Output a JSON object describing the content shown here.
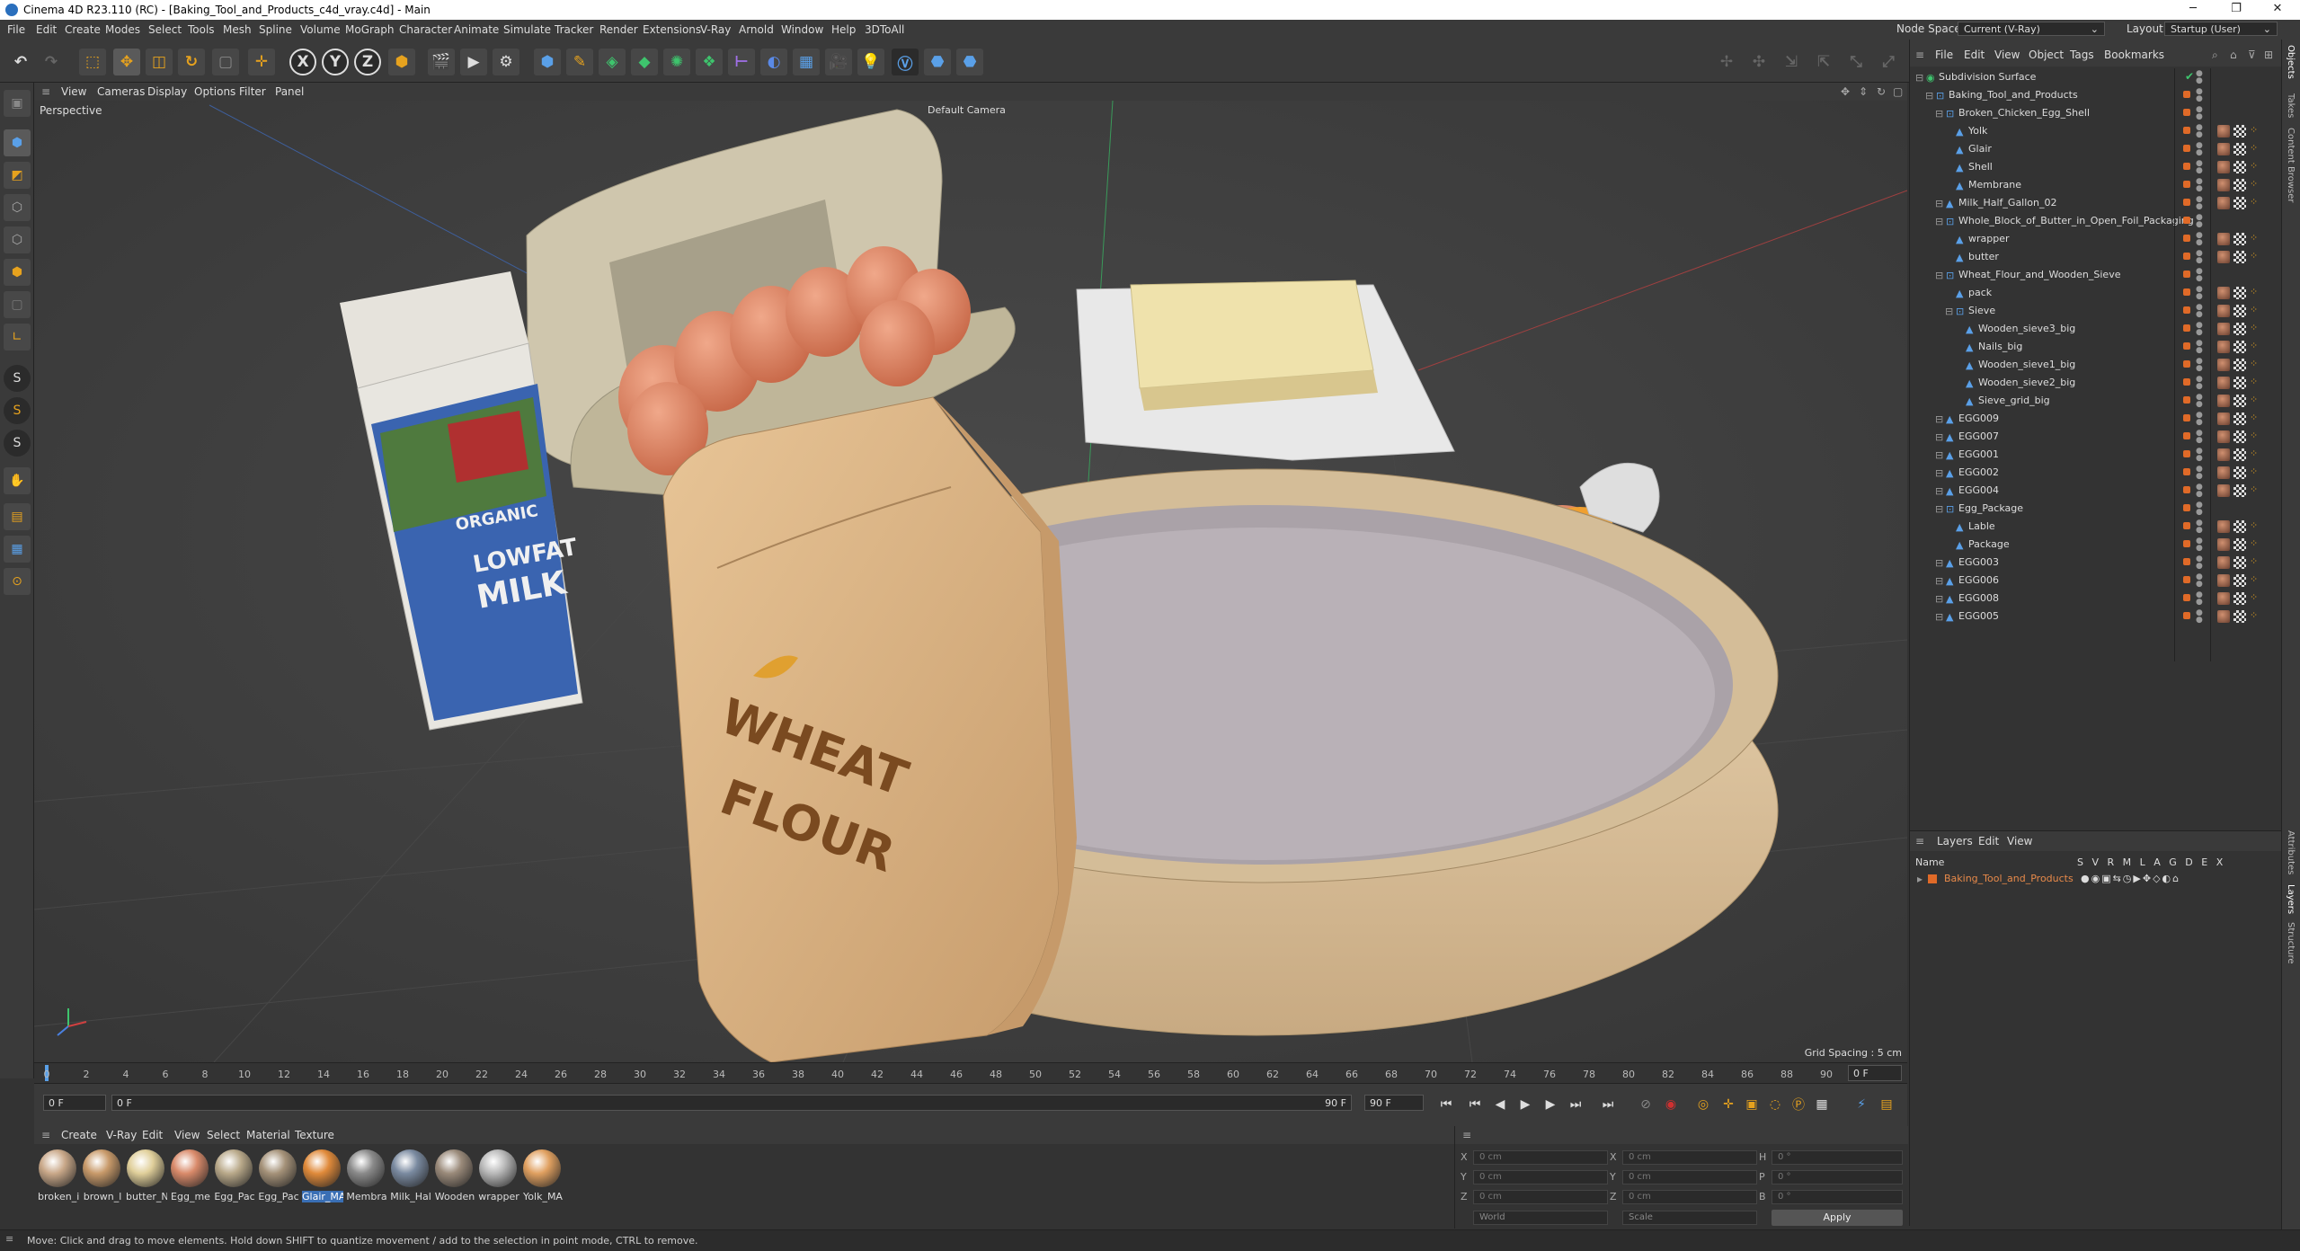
{
  "title": "Cinema 4D R23.110 (RC) - [Baking_Tool_and_Products_c4d_vray.c4d] - Main",
  "window_controls": [
    "─",
    "❐",
    "✕"
  ],
  "menu": [
    "File",
    "Edit",
    "Create",
    "Modes",
    "Select",
    "Tools",
    "Mesh",
    "Spline",
    "Volume",
    "MoGraph",
    "Character",
    "Animate",
    "Simulate",
    "Tracker",
    "Render",
    "Extensions",
    "V-Ray",
    "Arnold",
    "Window",
    "Help",
    "3DToAll"
  ],
  "node_space_label": "Node Space:",
  "node_space_value": "Current (V-Ray)",
  "layout_label": "Layout:",
  "layout_value": "Startup (User)",
  "toolbar": {
    "x": "X",
    "y": "Y",
    "z": "Z"
  },
  "viewport_menu": [
    "View",
    "Cameras",
    "Display",
    "Options",
    "Filter",
    "Panel"
  ],
  "viewport": {
    "name": "Perspective",
    "camera": "Default Camera",
    "grid_spacing": "Grid Spacing : 5 cm"
  },
  "scene_labels": {
    "milk_organic": "ORGANIC",
    "milk_lowfat": "LOWFAT",
    "milk_milk": "MILK",
    "flour_wheat": "WHEAT",
    "flour_flour": "FLOUR"
  },
  "timeline_ticks": [
    "0",
    "2",
    "4",
    "6",
    "8",
    "10",
    "12",
    "14",
    "16",
    "18",
    "20",
    "22",
    "24",
    "26",
    "28",
    "30",
    "32",
    "34",
    "36",
    "38",
    "40",
    "42",
    "44",
    "46",
    "48",
    "50",
    "52",
    "54",
    "56",
    "58",
    "60",
    "62",
    "64",
    "66",
    "68",
    "70",
    "72",
    "74",
    "76",
    "78",
    "80",
    "82",
    "84",
    "86",
    "88",
    "90"
  ],
  "timeline_frame": "0 F",
  "controls": {
    "start": "0 F",
    "current": "0 F",
    "end": "90 F",
    "end2": "90 F"
  },
  "material_menu": [
    "Create",
    "V-Ray",
    "Edit",
    "View",
    "Select",
    "Material",
    "Texture"
  ],
  "materials": [
    {
      "label": "broken_i",
      "color": "#c9a889"
    },
    {
      "label": "brown_l",
      "color": "#c89a6a"
    },
    {
      "label": "butter_N",
      "color": "#e0cf9a"
    },
    {
      "label": "Egg_me",
      "color": "#d98a6a"
    },
    {
      "label": "Egg_Pac",
      "color": "#b9a98a"
    },
    {
      "label": "Egg_Pac",
      "color": "#a59279"
    },
    {
      "label": "Glair_MA",
      "color": "#e08a3a"
    },
    {
      "label": "Membra",
      "color": "#8a8a8a"
    },
    {
      "label": "Milk_Hal",
      "color": "#7a8aa0"
    },
    {
      "label": "Wooden",
      "color": "#9a8a7a"
    },
    {
      "label": "wrapper",
      "color": "#b8b8b8"
    },
    {
      "label": "Yolk_MA",
      "color": "#e0a060"
    }
  ],
  "coords": {
    "x": "X",
    "y": "Y",
    "z": "Z",
    "h": "H",
    "p": "P",
    "b": "B",
    "val_cm": "0 cm",
    "val_deg": "0 °",
    "world": "World",
    "scale": "Scale",
    "apply": "Apply"
  },
  "status": "Move: Click and drag to move elements. Hold down SHIFT to quantize movement / add to the selection in point mode, CTRL to remove.",
  "objects_menu": [
    "File",
    "Edit",
    "View",
    "Object",
    "Tags",
    "Bookmarks"
  ],
  "objects": [
    {
      "name": "Subdivision Surface",
      "indent": 0
    },
    {
      "name": "Baking_Tool_and_Products",
      "indent": 1
    },
    {
      "name": "Broken_Chicken_Egg_Shell",
      "indent": 2
    },
    {
      "name": "Yolk",
      "indent": 3
    },
    {
      "name": "Glair",
      "indent": 3
    },
    {
      "name": "Shell",
      "indent": 3
    },
    {
      "name": "Membrane",
      "indent": 3
    },
    {
      "name": "Milk_Half_Gallon_02",
      "indent": 2
    },
    {
      "name": "Whole_Block_of_Butter_in_Open_Foil_Packaging",
      "indent": 2
    },
    {
      "name": "wrapper",
      "indent": 3
    },
    {
      "name": "butter",
      "indent": 3
    },
    {
      "name": "Wheat_Flour_and_Wooden_Sieve",
      "indent": 2
    },
    {
      "name": "pack",
      "indent": 3
    },
    {
      "name": "Sieve",
      "indent": 3
    },
    {
      "name": "Wooden_sieve3_big",
      "indent": 4
    },
    {
      "name": "Nails_big",
      "indent": 4
    },
    {
      "name": "Wooden_sieve1_big",
      "indent": 4
    },
    {
      "name": "Wooden_sieve2_big",
      "indent": 4
    },
    {
      "name": "Sieve_grid_big",
      "indent": 4
    },
    {
      "name": "EGG009",
      "indent": 2
    },
    {
      "name": "EGG007",
      "indent": 2
    },
    {
      "name": "EGG001",
      "indent": 2
    },
    {
      "name": "EGG002",
      "indent": 2
    },
    {
      "name": "EGG004",
      "indent": 2
    },
    {
      "name": "Egg_Package",
      "indent": 2
    },
    {
      "name": "Lable",
      "indent": 3
    },
    {
      "name": "Package",
      "indent": 3
    },
    {
      "name": "EGG003",
      "indent": 2
    },
    {
      "name": "EGG006",
      "indent": 2
    },
    {
      "name": "EGG008",
      "indent": 2
    },
    {
      "name": "EGG005",
      "indent": 2
    }
  ],
  "layers_menu": [
    "Layers",
    "Edit",
    "View"
  ],
  "layers_columns": {
    "name": "Name",
    "flags": "S V R M L A G D E X"
  },
  "layer_row": "Baking_Tool_and_Products",
  "right_tabs": [
    "Objects",
    "Takes",
    "Content Browser",
    "Attributes",
    "Layers",
    "Structure"
  ]
}
